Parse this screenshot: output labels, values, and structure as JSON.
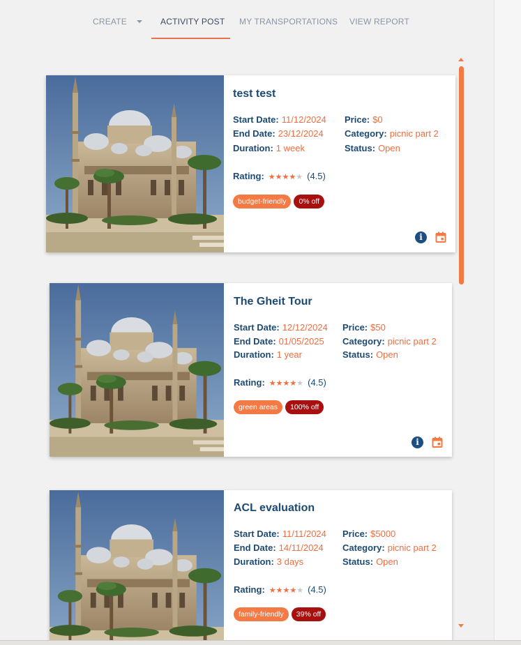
{
  "colors": {
    "accent": "#f47a45",
    "title": "#1d4a73",
    "value": "#f06d3f",
    "discount": "#a80f0f",
    "info_icon": "#1c4e82"
  },
  "nav": {
    "create": "CREATE",
    "activity_post": "ACTIVITY POST",
    "my_transportations": "MY TRANSPORTATIONS",
    "view_report": "VIEW REPORT"
  },
  "labels": {
    "start_date": "Start Date:",
    "end_date": "End Date:",
    "duration": "Duration:",
    "price": "Price:",
    "category": "Category:",
    "status": "Status:",
    "rating": "Rating:"
  },
  "activities": [
    {
      "title": "test test",
      "start_date": "11/12/2024",
      "end_date": "23/12/2024",
      "duration": "1 week",
      "price": "$0",
      "category": "picnic part 2",
      "status": "Open",
      "stars": "★★★★",
      "stars_off": "★",
      "rating": "(4.5)",
      "tag": "budget-friendly",
      "discount": "0% off",
      "image_icon": "mosque-photo",
      "info_icon": "info-icon",
      "calendar_icon": "calendar-icon"
    },
    {
      "title": "The Gheit Tour",
      "start_date": "12/12/2024",
      "end_date": "01/05/2025",
      "duration": "1 year",
      "price": "$50",
      "category": "picnic part 2",
      "status": "Open",
      "stars": "★★★★",
      "stars_off": "★",
      "rating": "(4.5)",
      "tag": "green areas",
      "discount": "100% off",
      "image_icon": "mosque-photo",
      "info_icon": "info-icon",
      "calendar_icon": "calendar-icon"
    },
    {
      "title": "ACL evaluation",
      "start_date": "11/11/2024",
      "end_date": "14/11/2024",
      "duration": "3 days",
      "price": "$5000",
      "category": "picnic part 2",
      "status": "Open",
      "stars": "★★★★",
      "stars_off": "★",
      "rating": "(4.5)",
      "tag": "family-friendly",
      "discount": "39% off",
      "image_icon": "mosque-photo",
      "info_icon": "info-icon",
      "calendar_icon": "calendar-icon"
    }
  ]
}
